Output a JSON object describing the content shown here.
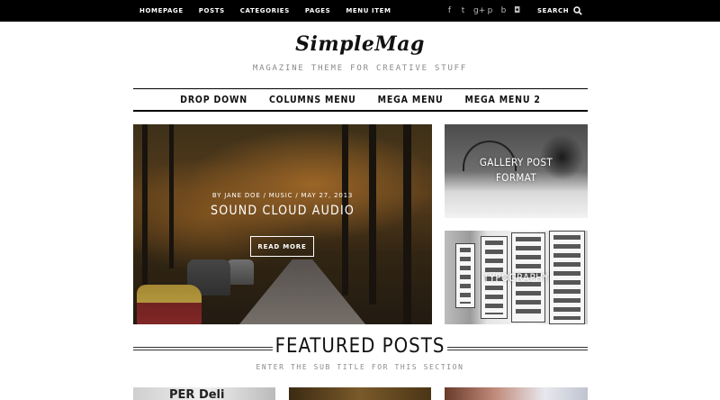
{
  "topbar": {
    "nav": [
      "HOMEPAGE",
      "POSTS",
      "CATEGORIES",
      "PAGES",
      "MENU ITEM"
    ],
    "social_icons": [
      "facebook-icon",
      "twitter-icon",
      "google-plus-icon",
      "pinterest-icon",
      "behance-icon",
      "instagram-icon"
    ],
    "social_glyphs": [
      "f",
      "t",
      "g+",
      "p",
      "b",
      "◘"
    ],
    "search_label": "SEARCH"
  },
  "header": {
    "logo": "SimpleMag",
    "tagline": "MAGAZINE THEME FOR CREATIVE STUFF"
  },
  "main_menu": [
    "DROP DOWN",
    "COLUMNS MENU",
    "MEGA MENU",
    "MEGA MENU 2"
  ],
  "hero": {
    "meta": "BY JANE DOE  /  MUSIC / MAY 27, 2013",
    "title": "SOUND CLOUD AUDIO",
    "button": "READ MORE"
  },
  "side_posts": [
    {
      "title_line1": "GALLERY POST",
      "title_line2": "FORMAT"
    },
    {
      "title_line1": "TYPOGRAPHY",
      "title_line2": "",
      "image_text": "PER FIRM"
    }
  ],
  "featured": {
    "title": "FEATURED POSTS",
    "subtitle": "ENTER THE SUB TITLE FOR THIS SECTION",
    "thumb1_text": "PER Deli"
  },
  "colors": {
    "topbar_bg": "#000000",
    "accent_text": "#8a8a8a"
  }
}
